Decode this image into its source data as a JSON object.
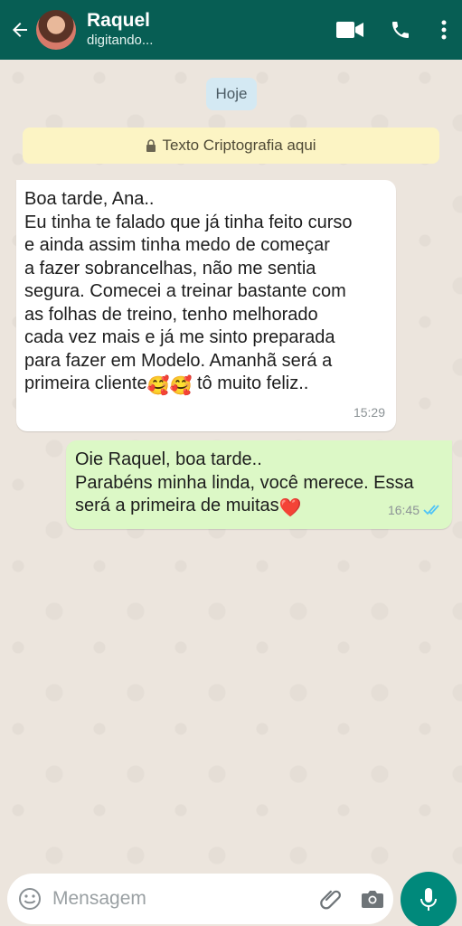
{
  "header": {
    "contact_name": "Raquel",
    "status": "digitando...",
    "icons": [
      "back-arrow-icon",
      "video-call-icon",
      "phone-call-icon",
      "more-options-icon"
    ]
  },
  "chat": {
    "date_chip": "Hoje",
    "encryption_banner": "Texto Criptografia aqui",
    "messages": [
      {
        "direction": "incoming",
        "text_part1": "Boa tarde, Ana..\nEu tinha te falado que já tinha feito curso\ne ainda assim tinha medo de começar\na fazer sobrancelhas, não me sentia\nsegura. Comecei a treinar bastante com\nas folhas de treino, tenho melhorado\ncada vez mais e já me sinto preparada\npara fazer em Modelo. Amanhã será a\nprimeira cliente",
        "emoji": "🥰🥰",
        "text_part2": " tô muito feliz..",
        "time": "15:29"
      },
      {
        "direction": "outgoing",
        "text": "Oie Raquel, boa tarde..\nParabéns minha linda, você merece. Essa\nserá a primeira de muitas",
        "emoji": "❤️",
        "time": "16:45",
        "status": "read"
      }
    ]
  },
  "composer": {
    "placeholder": "Mensagem",
    "value": ""
  },
  "colors": {
    "header": "#075e54",
    "chat_bg": "#ece5dd",
    "incoming_bubble": "#ffffff",
    "outgoing_bubble": "#dcf8c6",
    "mic_button": "#00897b",
    "read_ticks": "#4fc3f7"
  }
}
